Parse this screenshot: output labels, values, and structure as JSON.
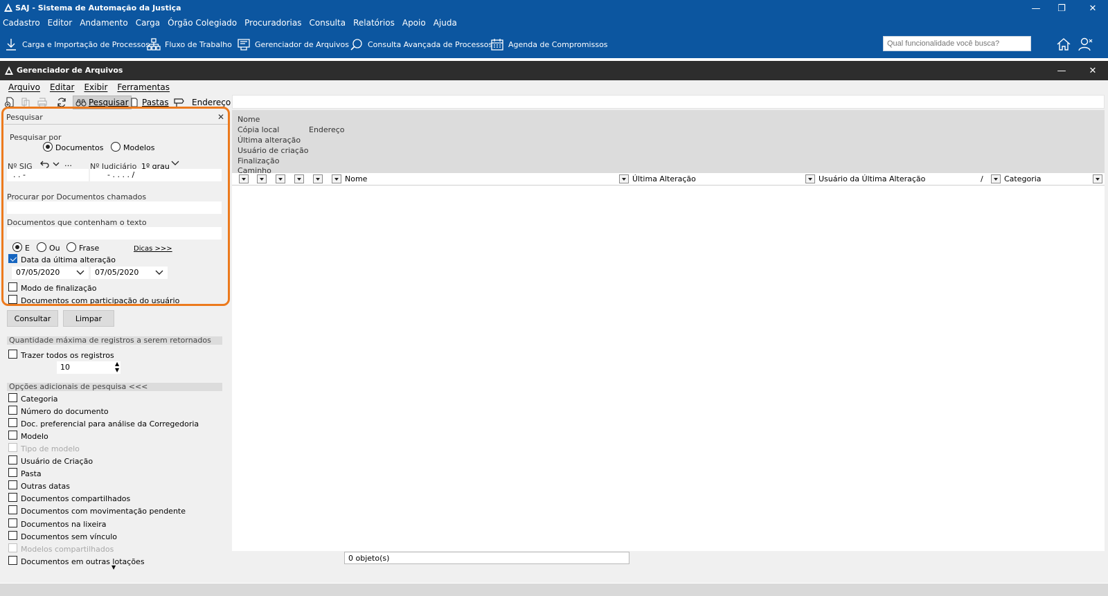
{
  "app": {
    "title": "SAJ - Sistema de Automação da Justiça",
    "menu": [
      "Cadastro",
      "Editor",
      "Andamento",
      "Carga",
      "Órgão Colegiado",
      "Procuradorias",
      "Consulta",
      "Relatórios",
      "Apoio",
      "Ajuda"
    ],
    "toolbar": {
      "carga": "Carga e Importação de Processos",
      "fluxo": "Fluxo de Trabalho",
      "gerenciador": "Gerenciador de Arquivos",
      "consulta": "Consulta Avançada de Processos",
      "agenda": "Agenda de Compromissos"
    },
    "search_placeholder": "Qual funcionalidade você busca?",
    "accent_color": "#0c56a0"
  },
  "window": {
    "title": "Gerenciador de Arquivos",
    "menu": [
      "Arquivo",
      "Editar",
      "Exibir",
      "Ferramentas"
    ],
    "toolbar": {
      "pesquisar": "Pesquisar",
      "pastas": "Pastas",
      "endereco": "Endereço"
    }
  },
  "search": {
    "header": "Pesquisar",
    "search_by_label": "Pesquisar por",
    "option_documentos": "Documentos",
    "option_modelos": "Modelos",
    "sig_label": "Nº SIG",
    "sig_value": ".   .      -",
    "judicial_label": "Nº Judiciário",
    "grau": "1º grau",
    "judicial_value": "-   .   .   .   .   /",
    "docs_called_label": "Procurar por Documentos chamados",
    "docs_text_label": "Documentos que contenham o texto",
    "radio_e": "E",
    "radio_ou": "Ou",
    "radio_frase": "Frase",
    "dicas": "Dicas >>>",
    "date_check_label": "Data da última alteração",
    "date_from": "07/05/2020",
    "date_to": "07/05/2020",
    "mode_finalizacao": "Modo de finalização",
    "docs_participacao": "Documentos com participação do usuário",
    "btn_consultar": "Consultar",
    "btn_limpar": "Limpar",
    "max_records_label": "Quantidade máxima de registros a serem retornados",
    "all_records_label": "Trazer todos os registros",
    "max_records_value": "10",
    "extra_options_label": "Opções adicionais de pesquisa <<<",
    "extra_options": [
      {
        "label": "Categoria",
        "disabled": false
      },
      {
        "label": "Número do documento",
        "disabled": false
      },
      {
        "label": "Doc. preferencial para análise da Corregedoria",
        "disabled": false
      },
      {
        "label": "Modelo",
        "disabled": false
      },
      {
        "label": "Tipo de modelo",
        "disabled": true
      },
      {
        "label": "Usuário de Criação",
        "disabled": false
      },
      {
        "label": "Pasta",
        "disabled": false
      },
      {
        "label": "Outras datas",
        "disabled": false
      },
      {
        "label": "Documentos compartilhados",
        "disabled": false
      },
      {
        "label": "Documentos com movimentação pendente",
        "disabled": false
      },
      {
        "label": "Documentos na lixeira",
        "disabled": false
      },
      {
        "label": "Documentos sem vínculo",
        "disabled": false
      },
      {
        "label": "Modelos compartilhados",
        "disabled": true
      },
      {
        "label": "Documentos em outras lotações",
        "disabled": false
      }
    ]
  },
  "details": {
    "nome": "Nome",
    "copia_local": "Cópia local",
    "endereco": "Endereço",
    "ultima_alteracao": "Última alteração",
    "usuario_criacao": "Usuário de criação",
    "finalizacao": "Finalização",
    "caminho": "Caminho"
  },
  "grid": {
    "col_nome": "Nome",
    "col_ultima_alteracao": "Última Alteração",
    "col_usuario": "Usuário da Última Alteração",
    "col_categoria": "Categoria",
    "sort_marker": "/",
    "status": "0 objeto(s)"
  }
}
